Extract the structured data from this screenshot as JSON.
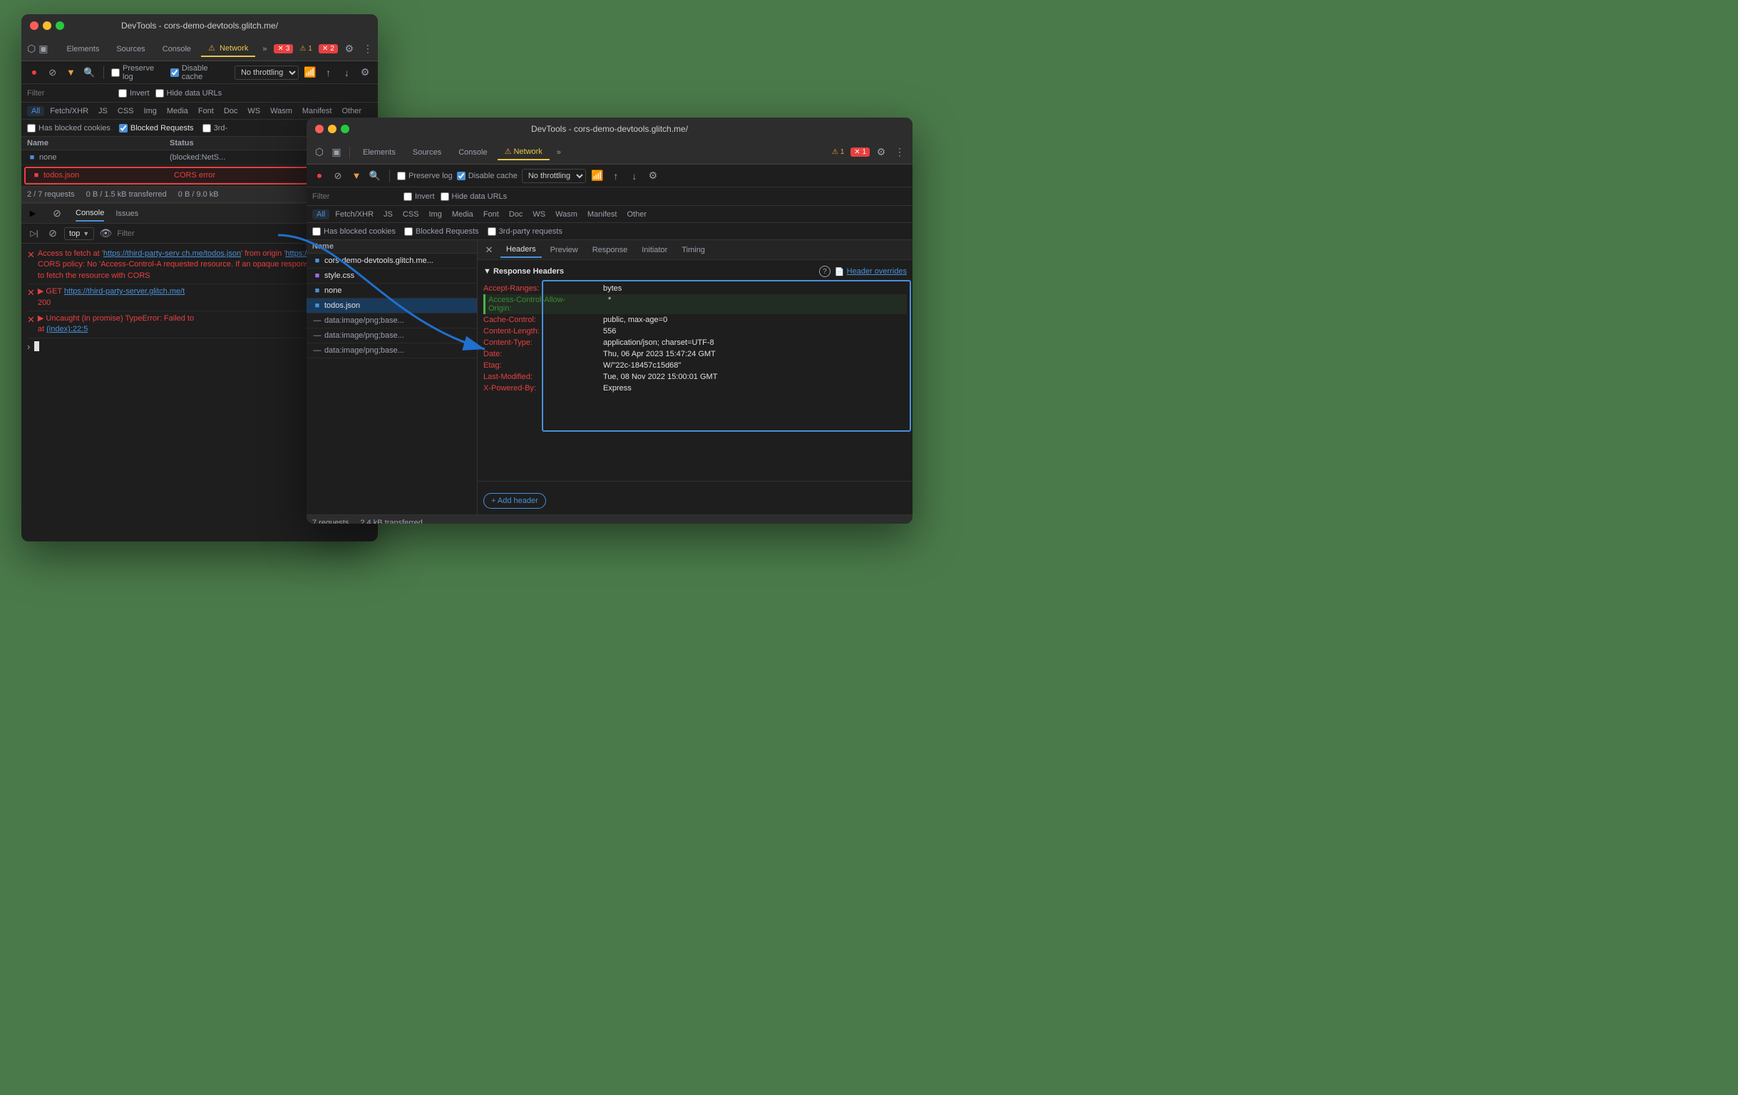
{
  "window1": {
    "title": "DevTools - cors-demo-devtools.glitch.me/",
    "tabs": [
      {
        "label": "Elements",
        "active": false
      },
      {
        "label": "Sources",
        "active": false
      },
      {
        "label": "Console",
        "active": false
      },
      {
        "label": "Network",
        "active": true
      },
      {
        "label": "»",
        "active": false
      }
    ],
    "badges": [
      {
        "type": "red",
        "icon": "✕",
        "count": "3"
      },
      {
        "type": "orange",
        "icon": "⚠",
        "count": "1"
      },
      {
        "type": "red",
        "icon": "✕",
        "count": "2"
      }
    ],
    "filterToolbar": {
      "preserveLog": "Preserve log",
      "disableCache": "Disable cache",
      "throttle": "No throttling"
    },
    "filterRow": {
      "placeholder": "Filter"
    },
    "resourceTypes": [
      "All",
      "Fetch/XHR",
      "JS",
      "CSS",
      "Img",
      "Media",
      "Font",
      "Doc",
      "WS",
      "Wasm",
      "Manifest",
      "Other"
    ],
    "activeResource": "All",
    "blockedCookies": "Has blocked cookies",
    "blockedRequests": "Blocked Requests",
    "thirdParty": "3rd-",
    "tableHeaders": {
      "name": "Name",
      "status": "Status"
    },
    "rows": [
      {
        "name": "none",
        "status": "(blocked:NetS...",
        "type": "doc",
        "error": false
      },
      {
        "name": "todos.json",
        "status": "CORS error",
        "type": "doc",
        "error": true,
        "selected": true
      }
    ],
    "statusBar": {
      "requests": "2 / 7 requests",
      "transferred": "0 B / 1.5 kB transferred",
      "resources": "0 B / 9.0 kB"
    },
    "console": {
      "tabs": [
        "Console",
        "Issues"
      ],
      "activeTab": "Console",
      "toolbarItems": [
        "top",
        "▶",
        "Filter"
      ],
      "errors": [
        {
          "icon": "✕",
          "text": "Access to fetch at 'https://third-party-serv ch.me/todos.json' from origin 'https://cors- blocked by CORS policy: No 'Access-Control-A requested resource. If an opaque response se to 'no-cors' to fetch the resource with CORS"
        },
        {
          "icon": "✕",
          "text": "▶ GET https://third-party-server.glitch.me/t 200"
        },
        {
          "icon": "✕",
          "text": "▶ Uncaught (in promise) TypeError: Failed to at (index):22:5"
        }
      ],
      "prompt": ">"
    }
  },
  "window2": {
    "title": "DevTools - cors-demo-devtools.glitch.me/",
    "tabs": [
      {
        "label": "Elements",
        "active": false
      },
      {
        "label": "Sources",
        "active": false
      },
      {
        "label": "Console",
        "active": false
      },
      {
        "label": "Network",
        "active": true
      },
      {
        "label": "»",
        "active": false
      }
    ],
    "badges": [
      {
        "type": "orange",
        "icon": "⚠",
        "count": "1"
      },
      {
        "type": "red",
        "icon": "✕",
        "count": "1"
      }
    ],
    "filterToolbar": {
      "preserveLog": "Preserve log",
      "disableCache": "Disable cache",
      "throttle": "No throttling"
    },
    "filterRow": {
      "placeholder": "Filter"
    },
    "resourceTypes": [
      "All",
      "Fetch/XHR",
      "JS",
      "CSS",
      "Img",
      "Media",
      "Font",
      "Doc",
      "WS",
      "Wasm",
      "Manifest",
      "Other"
    ],
    "activeResource": "All",
    "blockedCookies": "Has blocked cookies",
    "blockedRequests": "Blocked Requests",
    "thirdParty": "3rd-party requests",
    "tableHeaders": {
      "name": "Name"
    },
    "rows": [
      {
        "name": "cors-demo-devtools.glitch.me...",
        "type": "doc",
        "icon": "doc"
      },
      {
        "name": "style.css",
        "type": "css",
        "icon": "css"
      },
      {
        "name": "none",
        "type": "doc",
        "icon": "doc"
      },
      {
        "name": "todos.json",
        "type": "doc",
        "icon": "doc",
        "selected": true
      },
      {
        "name": "data:image/png;base...",
        "type": "img",
        "icon": "img"
      },
      {
        "name": "data:image/png;base...",
        "type": "img",
        "icon": "img"
      },
      {
        "name": "data:image/png;base...",
        "type": "img",
        "icon": "img"
      }
    ],
    "statusBar": {
      "requests": "7 requests",
      "transferred": "2.4 kB transferred"
    },
    "detailsTabs": [
      "Headers",
      "Preview",
      "Response",
      "Initiator",
      "Timing"
    ],
    "activeDetailsTab": "Headers",
    "responseHeaders": {
      "title": "▼ Response Headers",
      "headerOverrides": "Header overrides",
      "headers": [
        {
          "name": "Accept-Ranges:",
          "value": "bytes",
          "highlighted": false
        },
        {
          "name": "Access-Control-Allow-Origin:",
          "value": "*",
          "highlighted": true
        },
        {
          "name": "Cache-Control:",
          "value": "public, max-age=0",
          "highlighted": false
        },
        {
          "name": "Content-Length:",
          "value": "556",
          "highlighted": false
        },
        {
          "name": "Content-Type:",
          "value": "application/json; charset=UTF-8",
          "highlighted": false
        },
        {
          "name": "Date:",
          "value": "Thu, 06 Apr 2023 15:47:24 GMT",
          "highlighted": false
        },
        {
          "name": "Etag:",
          "value": "W/\"22c-18457c15d68\"",
          "highlighted": false
        },
        {
          "name": "Last-Modified:",
          "value": "Tue, 08 Nov 2022 15:00:01 GMT",
          "highlighted": false
        },
        {
          "name": "X-Powered-By:",
          "value": "Express",
          "highlighted": false
        }
      ],
      "addHeader": "+ Add header"
    }
  },
  "icons": {
    "cursor": "⬡",
    "mobile": "📱",
    "elements": "Elements",
    "sources": "Sources",
    "console": "Console",
    "network": "Network",
    "more": "»",
    "stop": "⏹",
    "clear": "⊘",
    "filter": "▼",
    "search": "🔍",
    "upload": "↑",
    "download": "↓",
    "settings": "⚙",
    "menu": "⋮",
    "wifi": "📶",
    "gear": "⚙",
    "eye": "👁",
    "expand": "▶"
  }
}
